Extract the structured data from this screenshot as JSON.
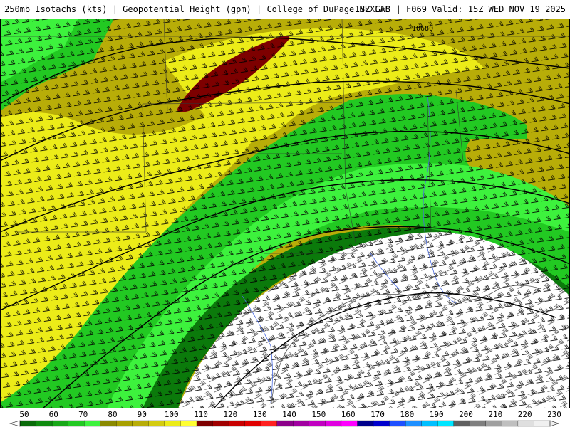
{
  "header": {
    "left_text": "250mb Isotachs (kts) | Geopotential Height (gpm) | College of DuPage NEXLAB",
    "right_text": "18Z GFS | F069 Valid: 15Z WED NOV 19 2025"
  },
  "map": {
    "contour_label": "10680",
    "colors": {
      "dark_green": "#0b7a0b",
      "green": "#22c922",
      "bright_green": "#3df23d",
      "olive": "#b8ad08",
      "yellow": "#ecec18",
      "dark_red": "#7d0000",
      "white": "#ffffff"
    }
  },
  "legend": {
    "labels": [
      "50",
      "60",
      "70",
      "80",
      "90",
      "100",
      "110",
      "120",
      "130",
      "140",
      "150",
      "160",
      "170",
      "180",
      "190",
      "200",
      "210",
      "220",
      "230"
    ],
    "colors": [
      "#0a6b0a",
      "#0f8a0f",
      "#18a818",
      "#22c922",
      "#3df23d",
      "#8a8a00",
      "#a8a000",
      "#b8ad08",
      "#d4cc10",
      "#ecec18",
      "#ffff33",
      "#7d0000",
      "#a00000",
      "#c80000",
      "#e00000",
      "#ff2020",
      "#8b0089",
      "#a000a0",
      "#c000c0",
      "#e000e0",
      "#ff00ff",
      "#00008b",
      "#0000cd",
      "#1e50ff",
      "#1e90ff",
      "#00bfff",
      "#00e5ff",
      "#5f5f5f",
      "#7f7f7f",
      "#9f9f9f",
      "#bfbfbf",
      "#dfdfdf",
      "#f0f0f0"
    ]
  }
}
